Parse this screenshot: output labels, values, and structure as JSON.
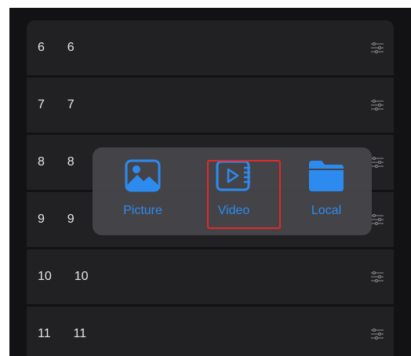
{
  "rows": [
    {
      "label": "6  6"
    },
    {
      "label": "7  7"
    },
    {
      "label": "8  8"
    },
    {
      "label": "9  9"
    },
    {
      "label": "10  10"
    },
    {
      "label": "11  11"
    }
  ],
  "row_icon": "sliders-icon",
  "picker": {
    "options": [
      {
        "label": "Picture",
        "icon": "picture-icon"
      },
      {
        "label": "Video",
        "icon": "video-icon"
      },
      {
        "label": "Local",
        "icon": "folder-icon"
      }
    ]
  },
  "colors": {
    "background": "#121214",
    "row": "#212124",
    "accent": "#2d8bf0",
    "highlight": "#e3282a",
    "text": "#e6e6e8"
  }
}
